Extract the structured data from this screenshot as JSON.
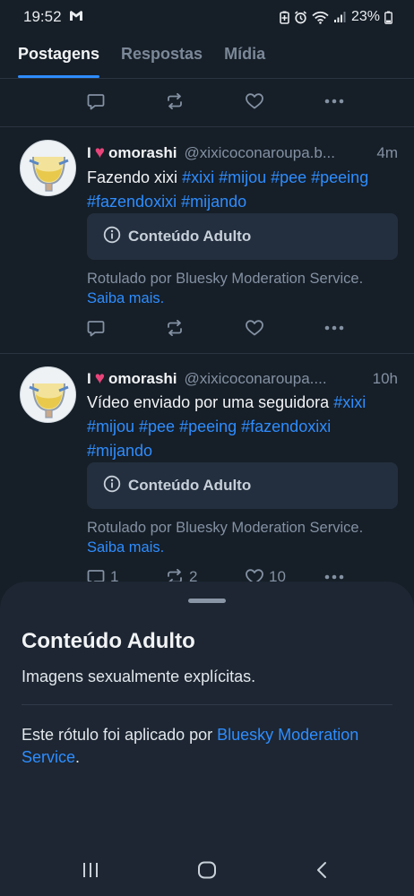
{
  "status": {
    "time": "19:52",
    "battery": "23%"
  },
  "tabs": [
    {
      "label": "Postagens"
    },
    {
      "label": "Respostas"
    },
    {
      "label": "Mídia"
    }
  ],
  "posts": [
    {
      "author": "omorashi",
      "author_prefix": "I",
      "handle": "@xixicoconaroupa.b...",
      "time": "4m",
      "text_plain": "Fazendo xixi ",
      "hashtags": "#xixi #mijou #pee #peeing #fazendoxixi #mijando",
      "warning": "Conteúdo Adulto",
      "label_note": "Rotulado por Bluesky Moderation Service.",
      "learn_more": "Saiba mais."
    },
    {
      "author": "omorashi",
      "author_prefix": "I",
      "handle": "@xixicoconaroupa....",
      "time": "10h",
      "text_plain": "Vídeo enviado por uma seguidora ",
      "hashtags": "#xixi #mijou #pee #peeing #fazendoxixi #mijando",
      "warning": "Conteúdo Adulto",
      "label_note": "Rotulado por Bluesky Moderation Service.",
      "learn_more": "Saiba mais.",
      "reply_count": "1",
      "repost_count": "2",
      "like_count": "10"
    }
  ],
  "sheet": {
    "title": "Conteúdo Adulto",
    "description": "Imagens sexualmente explícitas.",
    "source_prefix": "Este rótulo foi aplicado por ",
    "source_link": "Bluesky Moderation Service",
    "source_suffix": "."
  },
  "colors": {
    "background": "#161e27",
    "accent": "#2e8dff",
    "sheet": "#1d2632"
  }
}
